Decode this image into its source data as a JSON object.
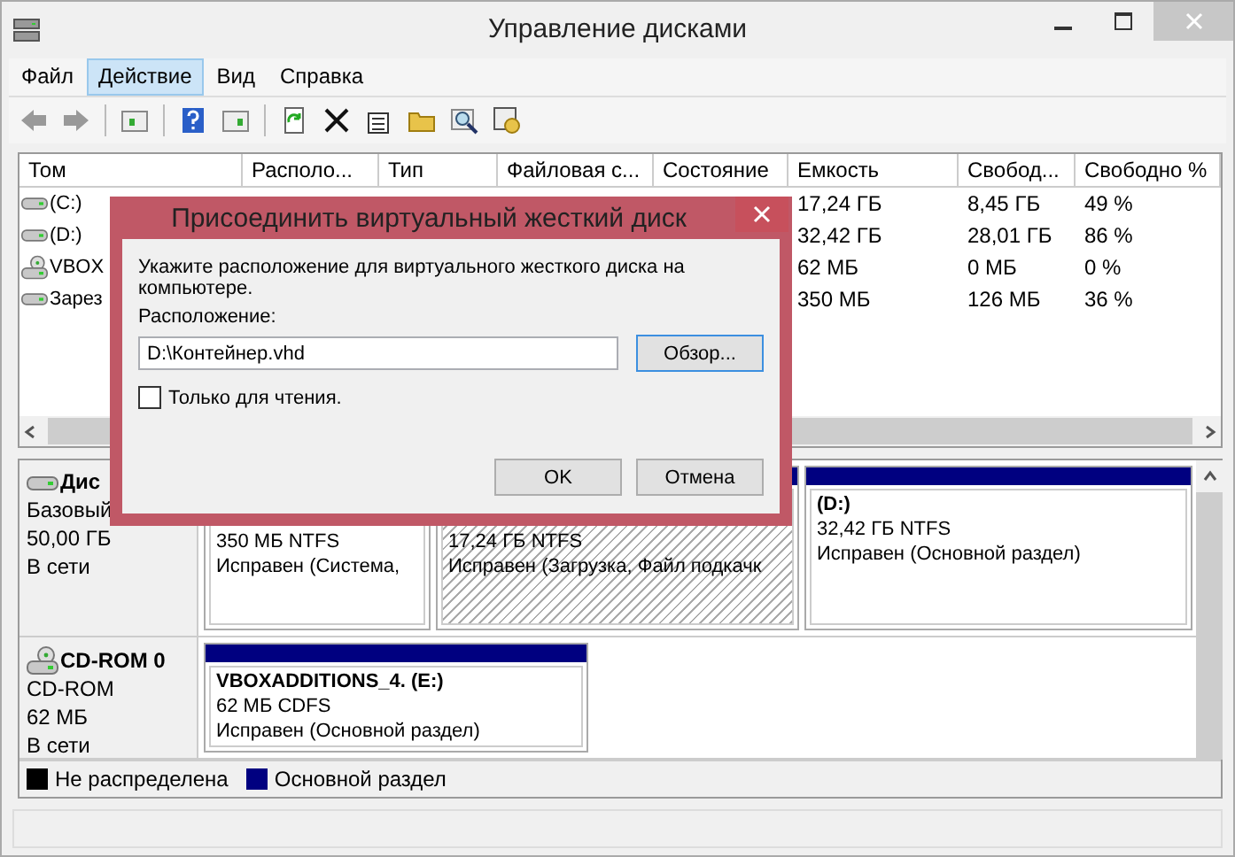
{
  "window": {
    "title": "Управление дисками"
  },
  "menu": [
    {
      "label": "Файл",
      "selected": false
    },
    {
      "label": "Действие",
      "selected": true
    },
    {
      "label": "Вид",
      "selected": false
    },
    {
      "label": "Справка",
      "selected": false
    }
  ],
  "volumes": {
    "columns": [
      "Том",
      "Располо...",
      "Тип",
      "Файловая с...",
      "Состояние",
      "Емкость",
      "Свобод...",
      "Свободно %"
    ],
    "rows": [
      {
        "kind": "disk",
        "name": "(C:)",
        "capacity": "17,24 ГБ",
        "free": "8,45 ГБ",
        "free_percent": "49 %"
      },
      {
        "kind": "disk",
        "name": "(D:)",
        "capacity": "32,42 ГБ",
        "free": "28,01 ГБ",
        "free_percent": "86 %"
      },
      {
        "kind": "cd",
        "name": "VBOX",
        "capacity": "62 МБ",
        "free": "0 МБ",
        "free_percent": "0 %"
      },
      {
        "kind": "disk",
        "name": "Зарез",
        "capacity": "350 МБ",
        "free": "126 МБ",
        "free_percent": "36 %"
      }
    ]
  },
  "disks": [
    {
      "kind": "disk",
      "name": "Дис",
      "type": "Базовый",
      "size": "50,00 ГБ",
      "status": "В сети",
      "partitions": [
        {
          "size": "350 МБ NTFS",
          "status": "Исправен (Система,",
          "selected": false
        },
        {
          "size": "17,24 ГБ NTFS",
          "status": "Исправен (Загрузка, Файл подкачк",
          "selected": true
        },
        {
          "label": "(D:)",
          "size": "32,42 ГБ NTFS",
          "status": "Исправен (Основной раздел)",
          "selected": false
        }
      ]
    },
    {
      "kind": "cd",
      "name": "CD-ROM 0",
      "type": "CD-ROM",
      "size": "62 МБ",
      "status": "В сети",
      "partitions": [
        {
          "label": "VBOXADDITIONS_4.  (E:)",
          "size": "62 МБ CDFS",
          "status": "Исправен (Основной раздел)",
          "selected": false
        }
      ]
    }
  ],
  "legend": [
    {
      "label": "Не распределена",
      "color": "#000000"
    },
    {
      "label": "Основной раздел",
      "color": "#000080"
    }
  ],
  "dialog": {
    "title": "Присоединить виртуальный жесткий диск",
    "message": "Укажите расположение для виртуального жесткого диска на компьютере.",
    "location_label": "Расположение:",
    "location": "D:\\Контейнер.vhd",
    "browse": "Обзор...",
    "readonly": {
      "label": "Только для чтения.",
      "checked": false
    },
    "buttons": [
      "OK",
      "Отмена"
    ]
  }
}
